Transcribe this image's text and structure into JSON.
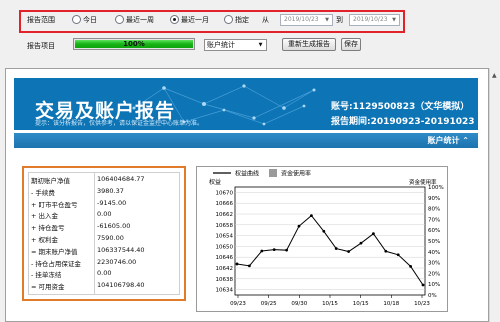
{
  "controls": {
    "range_label": "报告范围",
    "options": [
      "今日",
      "最近一周",
      "最近一月",
      "指定"
    ],
    "selected_option": "最近一月",
    "from_label": "从",
    "to_label": "到",
    "date_from": "2019/10/23",
    "date_to": "2019/10/23",
    "project_label": "报告项目",
    "progress_text": "100%",
    "progress_value": 1.0,
    "select_value": "账户统计",
    "regenerate_button": "重新生成报告",
    "save_button": "保存"
  },
  "report": {
    "title": "交易及账户报告",
    "hint": "提示：该分析报告，仅供参考，请以保证金监控中心账单为准。",
    "account": "账号:1129500823（文华模拟）",
    "period": "报告期间:20190923-20191023",
    "section_title": "账户统计 ⌃"
  },
  "account_stats": [
    {
      "label": "期初账户净值",
      "value": "106404684.77"
    },
    {
      "label": "- 手续费",
      "value": "3980.37"
    },
    {
      "label": "+ 盯市平仓盈亏",
      "value": "-9145.00"
    },
    {
      "label": "+ 出入金",
      "value": "0.00"
    },
    {
      "label": "+ 持仓盈亏",
      "value": "-61605.00"
    },
    {
      "label": "+ 权利金",
      "value": "7590.00"
    },
    {
      "label": "= 期末账户净值",
      "value": "106337544.40"
    },
    {
      "label": "- 持仓占用保证金",
      "value": "2230746.00"
    },
    {
      "label": "- 挂单冻结",
      "value": "0.00"
    },
    {
      "label": "= 可用资金",
      "value": "104106798.40"
    }
  ],
  "chart_data": {
    "type": "line",
    "legend": [
      "权益曲线",
      "资金使用率"
    ],
    "ylabel_left": "权益",
    "ylabel_right": "资金使用率",
    "y_ticks": [
      10634,
      10638,
      10642,
      10646,
      10650,
      10654,
      10658,
      10662,
      10666,
      10670
    ],
    "y_right_ticks": [
      "0%",
      "10%",
      "20%",
      "30%",
      "40%",
      "50%",
      "60%",
      "70%",
      "80%",
      "90%",
      "100%"
    ],
    "x_ticks": [
      "09/23",
      "09/25",
      "09/30",
      "10/15",
      "10/15",
      "10/18",
      "10/23"
    ],
    "ylim": [
      10632,
      10672
    ],
    "series": [
      {
        "name": "权益曲线",
        "color": "#000000",
        "values": [
          10643.5,
          10642.8,
          10648.3,
          10648.8,
          10648.6,
          10657.5,
          10661.4,
          10655.6,
          10649.2,
          10648.1,
          10651.2,
          10654.7,
          10648.2,
          10646.9,
          10642.6,
          10635.7
        ]
      }
    ]
  }
}
